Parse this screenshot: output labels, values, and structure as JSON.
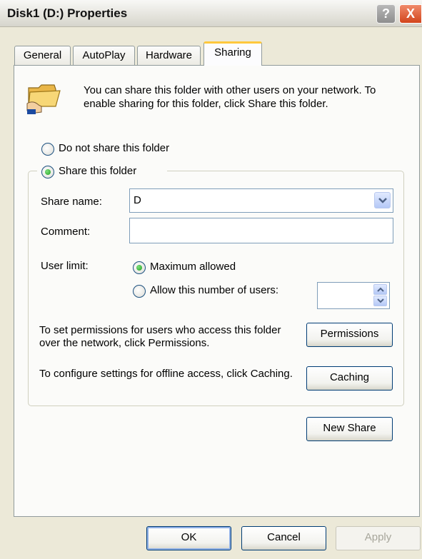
{
  "window": {
    "title": "Disk1 (D:) Properties"
  },
  "titlebar_buttons": {
    "help": "?",
    "close": "X"
  },
  "tabs": [
    {
      "label": "General"
    },
    {
      "label": "AutoPlay"
    },
    {
      "label": "Hardware"
    },
    {
      "label": "Sharing",
      "active": true
    }
  ],
  "intro": {
    "icon": "shared-folder-icon",
    "text": "You can share this folder with other users on your network.  To enable sharing for this folder, click Share this folder."
  },
  "sharing_options": {
    "do_not_share": {
      "label": "Do not share this folder",
      "checked": false
    },
    "share": {
      "label": "Share this folder",
      "checked": true
    }
  },
  "share_name": {
    "label": "Share name:",
    "value": "D"
  },
  "comment": {
    "label": "Comment:",
    "value": ""
  },
  "user_limit": {
    "label": "User limit:",
    "maximum": {
      "label": "Maximum allowed",
      "checked": true
    },
    "allow_number": {
      "label": "Allow this number of users:",
      "checked": false,
      "value": ""
    }
  },
  "permissions": {
    "text": "To set permissions for users who access this folder over the network, click Permissions.",
    "button": "Permissions"
  },
  "caching": {
    "text": "To configure settings for offline access, click Caching.",
    "button": "Caching"
  },
  "new_share_button": "New Share",
  "footer": {
    "ok": "OK",
    "cancel": "Cancel",
    "apply": "Apply"
  },
  "colors": {
    "dialog_bg": "#ece9d8",
    "tab_accent": "#ffc83c",
    "button_border": "#003c74"
  }
}
